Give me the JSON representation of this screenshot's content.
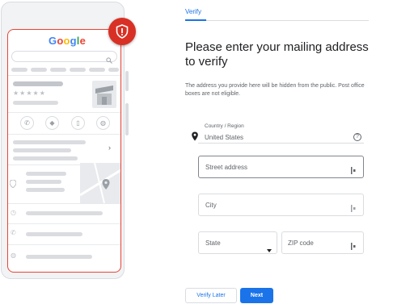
{
  "tab": {
    "label": "Verify"
  },
  "heading": "Please enter your mailing address to verify",
  "subtext": "The address you provide here will be hidden from the public. Post office boxes are not eligible.",
  "country": {
    "label": "Country / Region",
    "value": "United States"
  },
  "fields": {
    "street_placeholder": "Street address",
    "city_placeholder": "City",
    "state_placeholder": "State",
    "zip_placeholder": "ZIP code"
  },
  "buttons": {
    "verify_later": "Verify Later",
    "next": "Next"
  },
  "illustration": {
    "logo_text": "Google"
  },
  "colors": {
    "accent": "#1a73e8",
    "alert": "#d93025"
  },
  "icons": [
    "shield-alert-icon",
    "location-pin-icon",
    "help-icon",
    "dropdown-arrow-icon",
    "form-input-icon"
  ]
}
